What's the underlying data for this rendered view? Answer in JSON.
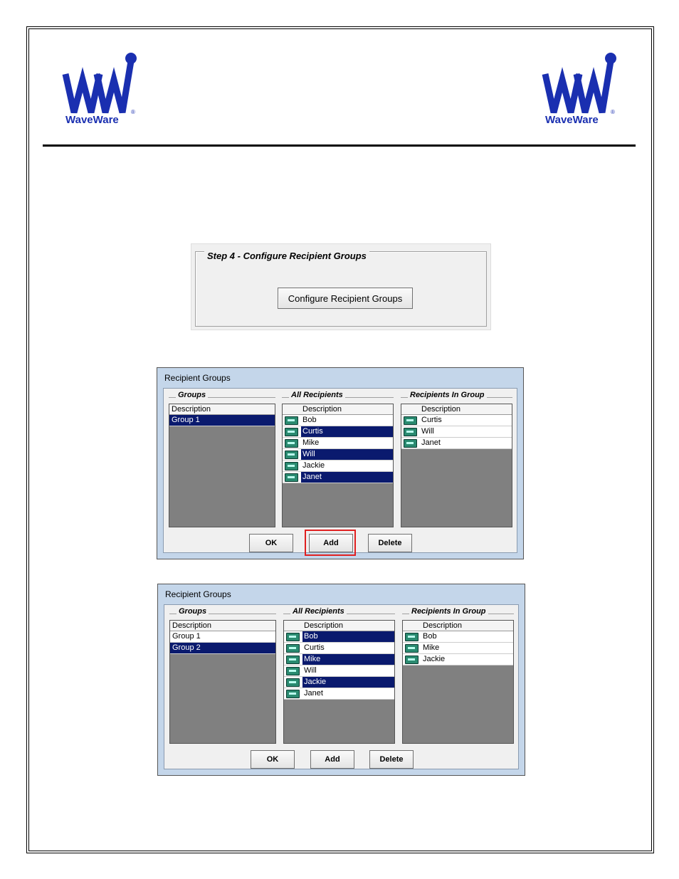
{
  "logo": {
    "text": "WaveWare",
    "registered": "®",
    "color": "#1a2fb0"
  },
  "step_panel": {
    "legend": "Step 4 - Configure Recipient Groups",
    "button_label": "Configure Recipient Groups"
  },
  "dialog1": {
    "title": "Recipient Groups",
    "groups_legend": "Groups",
    "all_legend": "All Recipients",
    "in_group_legend": "Recipients In Group",
    "column_header": "Description",
    "groups": [
      {
        "label": "Group 1",
        "selected": true
      }
    ],
    "all_recipients": [
      {
        "label": "Bob",
        "selected": false
      },
      {
        "label": "Curtis",
        "selected": true
      },
      {
        "label": "Mike",
        "selected": false
      },
      {
        "label": "Will",
        "selected": true
      },
      {
        "label": "Jackie",
        "selected": false
      },
      {
        "label": "Janet",
        "selected": true
      }
    ],
    "in_group": [
      "Curtis",
      "Will",
      "Janet"
    ],
    "buttons": {
      "ok": "OK",
      "add": "Add",
      "delete": "Delete"
    }
  },
  "dialog2": {
    "title": "Recipient Groups",
    "groups_legend": "Groups",
    "all_legend": "All Recipients",
    "in_group_legend": "Recipients In Group",
    "column_header": "Description",
    "groups": [
      {
        "label": "Group 1",
        "selected": false
      },
      {
        "label": "Group 2",
        "selected": true
      }
    ],
    "all_recipients": [
      {
        "label": "Bob",
        "selected": true
      },
      {
        "label": "Curtis",
        "selected": false
      },
      {
        "label": "Mike",
        "selected": true
      },
      {
        "label": "Will",
        "selected": false
      },
      {
        "label": "Jackie",
        "selected": true
      },
      {
        "label": "Janet",
        "selected": false
      }
    ],
    "in_group": [
      "Bob",
      "Mike",
      "Jackie"
    ],
    "buttons": {
      "ok": "OK",
      "add": "Add",
      "delete": "Delete"
    }
  }
}
